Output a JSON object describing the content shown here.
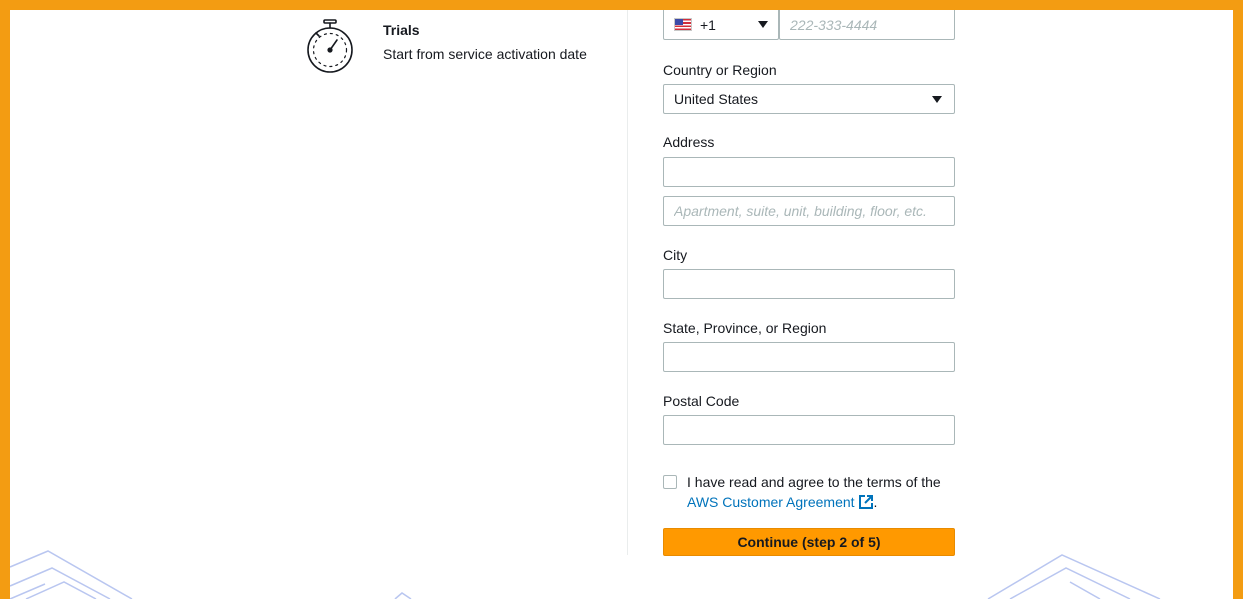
{
  "trials": {
    "icon": "stopwatch-icon",
    "title": "Trials",
    "description": "Start from service activation date"
  },
  "phone": {
    "country_code": "+1",
    "flag_icon": "us-flag-icon",
    "number_placeholder": "222-333-4444"
  },
  "country": {
    "label": "Country or Region",
    "selected": "United States"
  },
  "address": {
    "label": "Address",
    "line1_value": "",
    "line2_placeholder": "Apartment, suite, unit, building, floor, etc."
  },
  "city": {
    "label": "City",
    "value": ""
  },
  "state": {
    "label": "State, Province, or Region",
    "value": ""
  },
  "postal": {
    "label": "Postal Code",
    "value": ""
  },
  "agreement": {
    "text": "I have read and agree to the terms of the",
    "link_text": "AWS Customer Agreement",
    "suffix": ".",
    "checked": false
  },
  "continue_button": {
    "label": "Continue (step 2 of 5)"
  },
  "colors": {
    "accent": "#ff9900",
    "frame": "#f39c12",
    "link": "#0073bb",
    "decor": "#b9c6f0"
  }
}
